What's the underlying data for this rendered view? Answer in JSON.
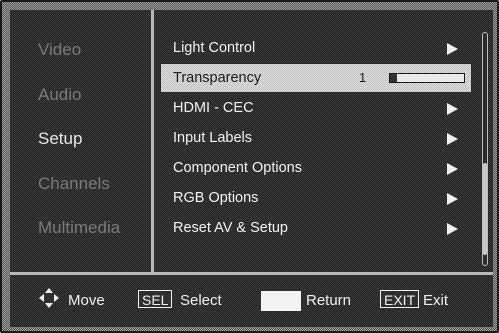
{
  "sidebar": {
    "items": [
      {
        "label": "Video"
      },
      {
        "label": "Audio"
      },
      {
        "label": "Setup"
      },
      {
        "label": "Channels"
      },
      {
        "label": "Multimedia"
      }
    ]
  },
  "menu": {
    "items": [
      {
        "label": "Light Control"
      },
      {
        "label": "Transparency",
        "value": "1",
        "slider_fraction": 0.1
      },
      {
        "label": "HDMI - CEC"
      },
      {
        "label": "Input Labels"
      },
      {
        "label": "Component Options"
      },
      {
        "label": "RGB Options"
      },
      {
        "label": "Reset AV & Setup"
      }
    ]
  },
  "footer": {
    "move_label": "Move",
    "sel_key": "SEL",
    "select_label": "Select",
    "return_label": "Return",
    "exit_key": "EXIT",
    "exit_label": "Exit"
  },
  "icons": {
    "move": "four-way-arrow-icon",
    "submenu": "triangle-right-icon"
  }
}
